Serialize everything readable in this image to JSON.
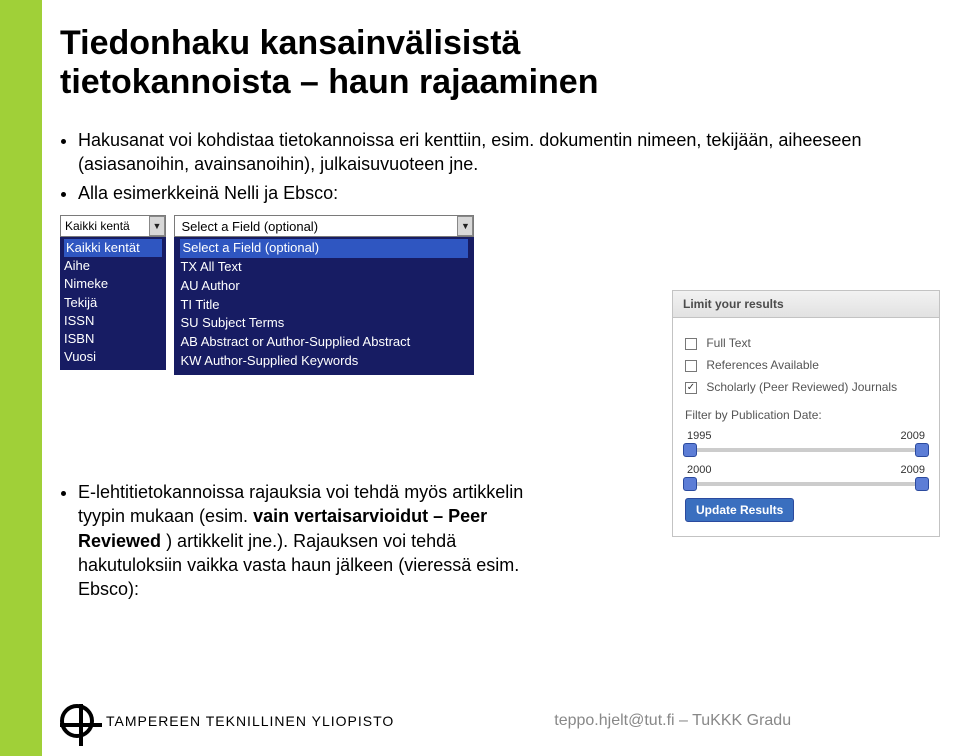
{
  "title_line1": "Tiedonhaku kansainvälisistä",
  "title_line2": "tietokannoista – haun rajaaminen",
  "intro": {
    "b1a": "Hakusanat voi kohdistaa tietokannoissa eri kenttiin, esim. dokumentin nimeen, tekijään, aiheeseen (asiasanoihin, avainsanoihin), julkaisuvuoteen jne.",
    "b2": "Alla esimerkkeinä Nelli ja Ebsco:"
  },
  "nelli": {
    "selected": "Kaikki kentä",
    "items": [
      "Kaikki kentät",
      "Aihe",
      "Nimeke",
      "Tekijä",
      "ISSN",
      "ISBN",
      "Vuosi"
    ]
  },
  "ebsco": {
    "selected": "Select a Field (optional)",
    "items": [
      "Select a Field (optional)",
      "TX All Text",
      "AU Author",
      "TI Title",
      "SU Subject Terms",
      "AB Abstract or Author-Supplied Abstract",
      "KW Author-Supplied Keywords"
    ]
  },
  "lower": {
    "b1": "E-lehtitietokannoissa rajauksia voi tehdä myös artikkelin tyypin mukaan (esim. ",
    "b1_bold": "vain vertaisarvioidut – Peer Reviewed",
    "b1_tail": ") artikkelit jne.). Rajauksen voi tehdä hakutuloksiin vaikka vasta haun jälkeen (vieressä esim. Ebsco):"
  },
  "limit": {
    "header": "Limit your results",
    "fulltext": "Full Text",
    "refs": "References Available",
    "scholarly": "Scholarly (Peer Reviewed) Journals",
    "filter_label": "Filter by Publication Date:",
    "y1": "1995",
    "y2": "2009",
    "y3": "2000",
    "y4": "2009",
    "update": "Update Results"
  },
  "footer": {
    "uni": "TAMPEREEN TEKNILLINEN YLIOPISTO",
    "credit": "teppo.hjelt@tut.fi – TuKKK Gradu"
  }
}
